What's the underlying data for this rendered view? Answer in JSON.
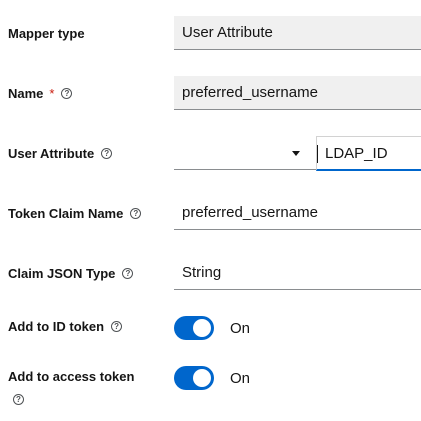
{
  "form": {
    "mapper_type": {
      "label": "Mapper type",
      "value": "User Attribute"
    },
    "name": {
      "label": "Name",
      "required_marker": "*",
      "value": "preferred_username"
    },
    "user_attribute": {
      "label": "User Attribute",
      "select_value": "",
      "typeahead_value": "LDAP_ID"
    },
    "token_claim_name": {
      "label": "Token Claim Name",
      "value": "preferred_username"
    },
    "claim_json_type": {
      "label": "Claim JSON Type",
      "value": "String"
    },
    "add_to_id_token": {
      "label": "Add to ID token",
      "state": "On",
      "enabled": true
    },
    "add_to_access_token": {
      "label": "Add to access token",
      "state": "On",
      "enabled": true
    }
  },
  "icons": {
    "help": "help-circle-icon",
    "dropdown": "caret-down-icon"
  },
  "colors": {
    "accent": "#0066cc",
    "required": "#c9190b",
    "readonly_bg": "#f0f0f0"
  }
}
